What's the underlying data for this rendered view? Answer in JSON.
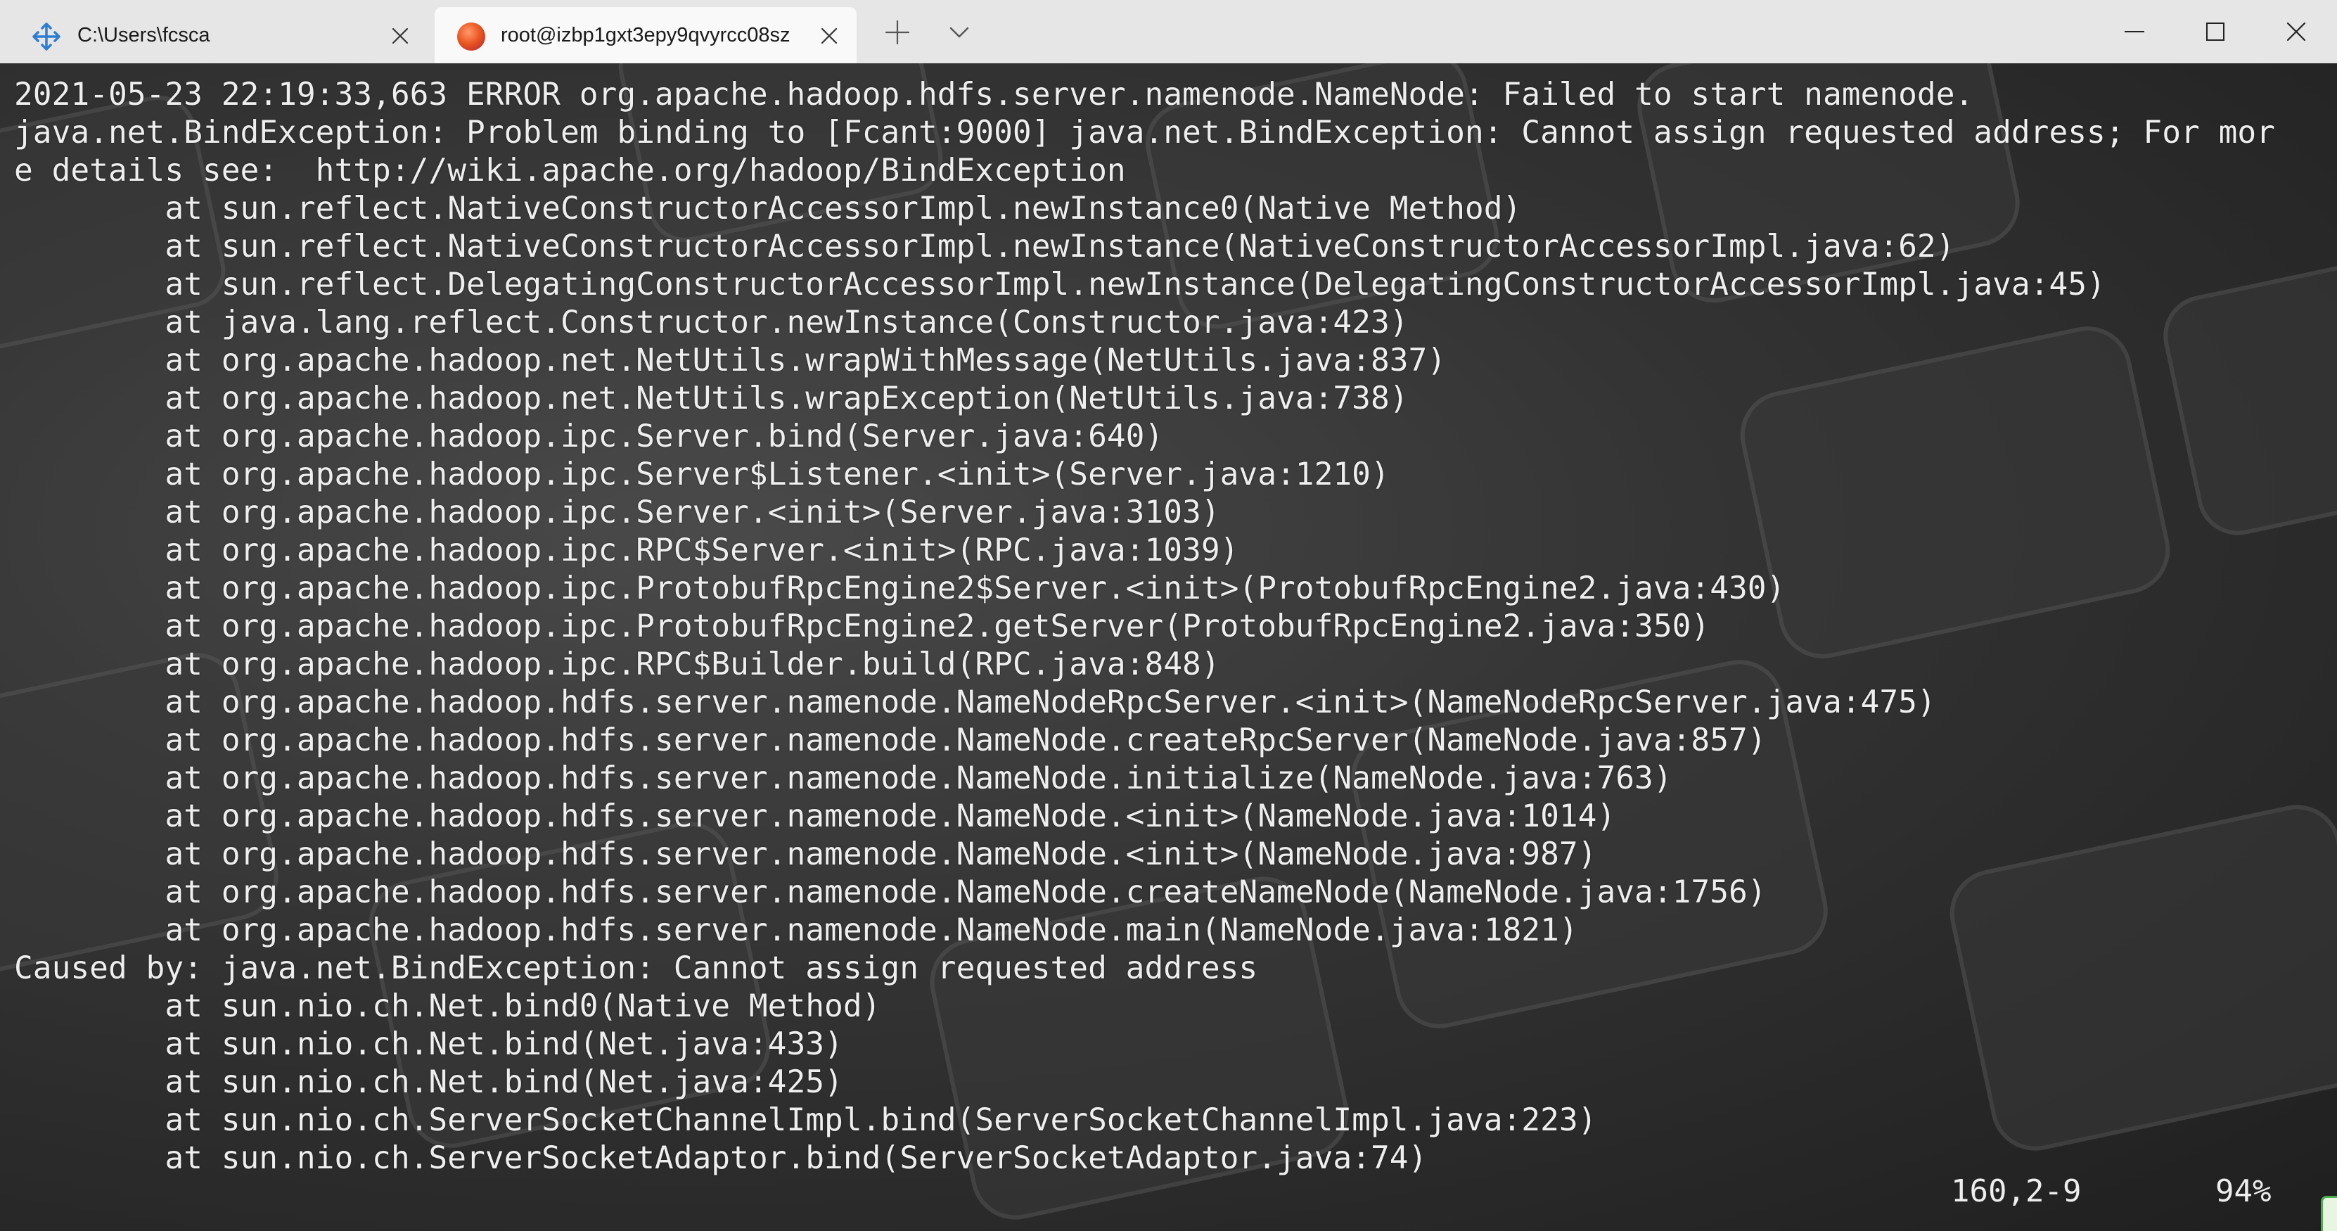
{
  "tabs": [
    {
      "title": "C:\\Users\\fcsca",
      "icon": "powershell-move-icon",
      "active": false
    },
    {
      "title": "root@izbp1gxt3epy9qvyrcc08sz",
      "icon": "ubuntu-circle-icon",
      "active": true
    }
  ],
  "window_controls": [
    "minimize",
    "maximize",
    "close"
  ],
  "terminal": {
    "lines": [
      "2021-05-23 22:19:33,663 ERROR org.apache.hadoop.hdfs.server.namenode.NameNode: Failed to start namenode.",
      "java.net.BindException: Problem binding to [Fcant:9000] java.net.BindException: Cannot assign requested address; For mor",
      "e details see:  http://wiki.apache.org/hadoop/BindException",
      "        at sun.reflect.NativeConstructorAccessorImpl.newInstance0(Native Method)",
      "        at sun.reflect.NativeConstructorAccessorImpl.newInstance(NativeConstructorAccessorImpl.java:62)",
      "        at sun.reflect.DelegatingConstructorAccessorImpl.newInstance(DelegatingConstructorAccessorImpl.java:45)",
      "        at java.lang.reflect.Constructor.newInstance(Constructor.java:423)",
      "        at org.apache.hadoop.net.NetUtils.wrapWithMessage(NetUtils.java:837)",
      "        at org.apache.hadoop.net.NetUtils.wrapException(NetUtils.java:738)",
      "        at org.apache.hadoop.ipc.Server.bind(Server.java:640)",
      "        at org.apache.hadoop.ipc.Server$Listener.<init>(Server.java:1210)",
      "        at org.apache.hadoop.ipc.Server.<init>(Server.java:3103)",
      "        at org.apache.hadoop.ipc.RPC$Server.<init>(RPC.java:1039)",
      "        at org.apache.hadoop.ipc.ProtobufRpcEngine2$Server.<init>(ProtobufRpcEngine2.java:430)",
      "        at org.apache.hadoop.ipc.ProtobufRpcEngine2.getServer(ProtobufRpcEngine2.java:350)",
      "        at org.apache.hadoop.ipc.RPC$Builder.build(RPC.java:848)",
      "        at org.apache.hadoop.hdfs.server.namenode.NameNodeRpcServer.<init>(NameNodeRpcServer.java:475)",
      "        at org.apache.hadoop.hdfs.server.namenode.NameNode.createRpcServer(NameNode.java:857)",
      "        at org.apache.hadoop.hdfs.server.namenode.NameNode.initialize(NameNode.java:763)",
      "        at org.apache.hadoop.hdfs.server.namenode.NameNode.<init>(NameNode.java:1014)",
      "        at org.apache.hadoop.hdfs.server.namenode.NameNode.<init>(NameNode.java:987)",
      "        at org.apache.hadoop.hdfs.server.namenode.NameNode.createNameNode(NameNode.java:1756)",
      "        at org.apache.hadoop.hdfs.server.namenode.NameNode.main(NameNode.java:1821)",
      "Caused by: java.net.BindException: Cannot assign requested address",
      "        at sun.nio.ch.Net.bind0(Native Method)",
      "        at sun.nio.ch.Net.bind(Net.java:433)",
      "        at sun.nio.ch.Net.bind(Net.java:425)",
      "        at sun.nio.ch.ServerSocketChannelImpl.bind(ServerSocketChannelImpl.java:223)",
      "        at sun.nio.ch.ServerSocketAdaptor.bind(ServerSocketAdaptor.java:74)"
    ],
    "status_position": "160,2-9",
    "status_percent": "94%",
    "background": "keyboard-wallpaper"
  },
  "colors": {
    "tabbar_bg": "#e6e6e6",
    "active_tab_bg": "#f9f9f9",
    "terminal_text": "#eeeeee",
    "ubuntu_orange": "#e95420",
    "powershell_blue": "#2d7dd2"
  }
}
